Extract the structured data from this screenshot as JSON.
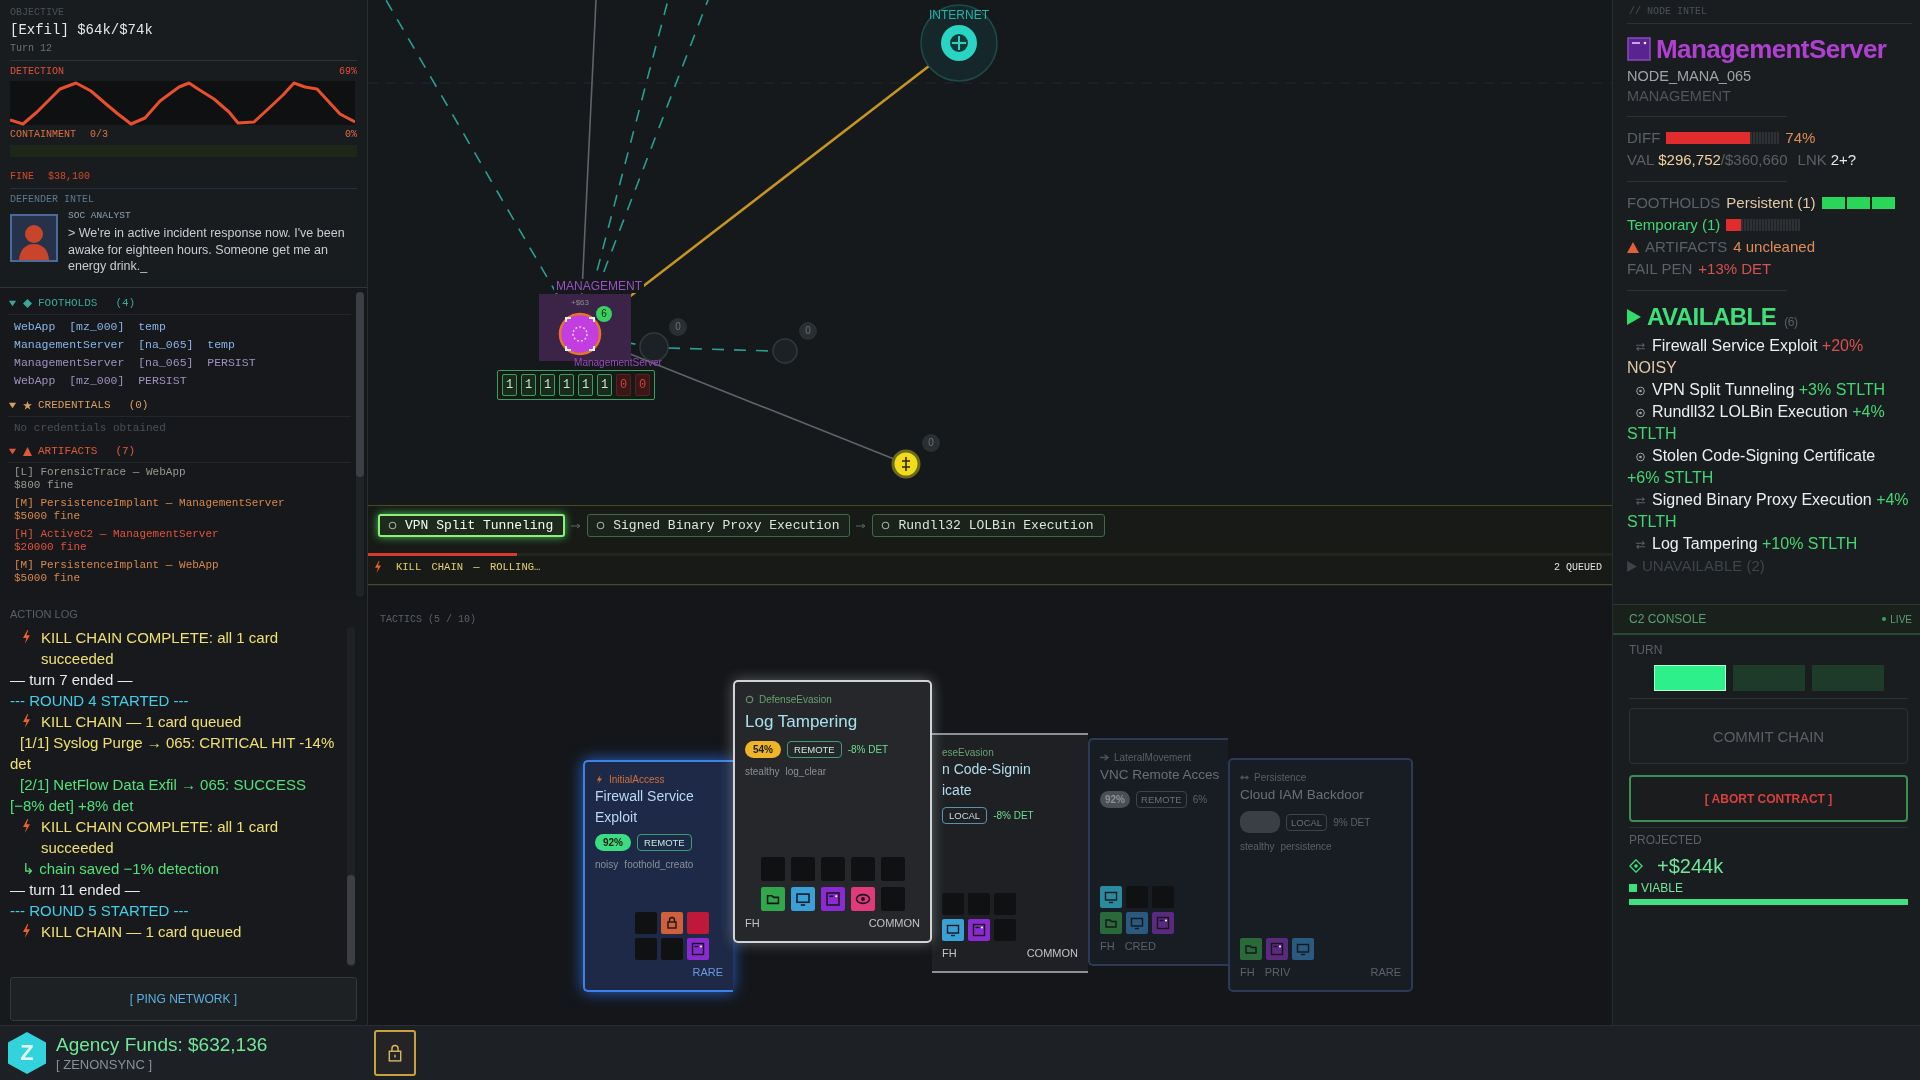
{
  "objective": {
    "label": "OBJECTIVE",
    "goal": "[Exfil] $64k/$74k",
    "turn": "Turn 12"
  },
  "detection": {
    "label": "DETECTION",
    "value": "69%"
  },
  "containment": {
    "label": "CONTAINMENT",
    "count": "0/3",
    "value": "0%"
  },
  "fine": {
    "label": "FINE",
    "value": "$38,100"
  },
  "defender": {
    "label": "DEFENDER INTEL",
    "role": "SOC ANALYST",
    "message": "> We're in active incident response now. I've been awake for eighteen hours. Someone get me an energy drink._"
  },
  "footholds": {
    "title": "FOOTHOLDS",
    "count": "(4)",
    "expanded": true,
    "items": [
      {
        "kind": "temp",
        "node": "WebApp",
        "id": "[mz_000]",
        "mode": "temp"
      },
      {
        "kind": "temp",
        "node": "ManagementServer",
        "id": "[na_065]",
        "mode": "temp"
      },
      {
        "kind": "persist",
        "node": "ManagementServer",
        "id": "[na_065]",
        "mode": "PERSIST"
      },
      {
        "kind": "persist",
        "node": "WebApp",
        "id": "[mz_000]",
        "mode": "PERSIST"
      }
    ]
  },
  "credentials": {
    "title": "CREDENTIALS",
    "count": "(0)",
    "expanded": true,
    "empty": "No credentials obtained"
  },
  "artifacts": {
    "title": "ARTIFACTS",
    "count": "(7)",
    "expanded": true,
    "items": [
      {
        "kind": "low",
        "name": "[L] ForensicTrace — WebApp",
        "fine": "$800 fine"
      },
      {
        "kind": "medium",
        "name": "[M] PersistenceImplant — ManagementServer",
        "fine": "$5000 fine"
      },
      {
        "kind": "high",
        "name": "[H] ActiveC2 — ManagementServer",
        "fine": "$20000 fine"
      },
      {
        "kind": "medium",
        "name": "[M] PersistenceImplant — WebApp",
        "fine": "$5000 fine"
      }
    ]
  },
  "action_log": {
    "title": "ACTION LOG",
    "entries": [
      {
        "kind": "chain",
        "text": "KILL CHAIN COMPLETE: all 1 card succeeded"
      },
      {
        "kind": "turn",
        "text": "— turn 7 ended —"
      },
      {
        "kind": "round",
        "text": "--- ROUND 4 STARTED ---"
      },
      {
        "kind": "chain",
        "text": "KILL CHAIN — 1 card queued"
      },
      {
        "kind": "hit",
        "text": "[1/1] Syslog Purge → 065: CRITICAL HIT -14% det"
      },
      {
        "kind": "success",
        "text": "[2/1] NetFlow Data Exfil → 065: SUCCESS [−8% det] +8% det"
      },
      {
        "kind": "chain",
        "text": "KILL CHAIN COMPLETE: all 1 card succeeded"
      },
      {
        "kind": "saved",
        "text": "↳ chain saved −1% detection"
      },
      {
        "kind": "turn",
        "text": "— turn 11 ended —"
      },
      {
        "kind": "round",
        "text": "--- ROUND 5 STARTED ---"
      },
      {
        "kind": "chain",
        "text": "KILL CHAIN — 1 card queued"
      }
    ]
  },
  "ping_button": "[ PING NETWORK ]",
  "funds": {
    "logo": "Z",
    "amount": "Agency Funds: $632,136",
    "agency": "[ ZENONSYNC ]"
  },
  "map": {
    "internet": {
      "label": "INTERNET"
    },
    "server": {
      "label": "MANAGEMENT",
      "value": "+$63",
      "name": "ManagementServer",
      "badge": "6"
    },
    "spots": [
      {
        "kind": "ghost",
        "badge": "0"
      },
      {
        "kind": "ghost",
        "badge": "0"
      },
      {
        "kind": "target",
        "badge": "0"
      }
    ],
    "foothold_cells": [
      {
        "value": "1",
        "on": true
      },
      {
        "value": "1",
        "on": true
      },
      {
        "value": "1",
        "on": true
      },
      {
        "value": "1",
        "on": true
      },
      {
        "value": "1",
        "on": true
      },
      {
        "value": "1",
        "on": true
      },
      {
        "value": "0",
        "on": false
      },
      {
        "value": "0",
        "on": false
      }
    ]
  },
  "kill_chain": {
    "items": [
      {
        "label": "VPN Split Tunneling",
        "selected": true
      },
      {
        "label": "Signed Binary Proxy Execution",
        "selected": false
      },
      {
        "label": "Rundll32 LOLBin Execution",
        "selected": false
      }
    ],
    "level": 0.12,
    "status": "KILL CHAIN — ROLLING…",
    "queued": "2 QUEUED"
  },
  "tactics": {
    "title": "TACTICS (5 / 10)",
    "cards": [
      {
        "kind": "highlighted",
        "category": "InitialAccess",
        "title_lines": [
          "Firewall Service",
          "Exploit"
        ],
        "chance": {
          "text": "92%",
          "color": "#3ddc84"
        },
        "range": "REMOTE",
        "tags": [
          "noisy",
          "foothold_creato"
        ],
        "slots": [
          {
            "kind": "empty"
          },
          {
            "kind": "lock",
            "color": "#d0603a"
          },
          {
            "kind": "block",
            "color": "#c01838"
          },
          {
            "kind": "empty"
          },
          {
            "kind": "empty"
          },
          {
            "kind": "server",
            "color": "#8a2ad0"
          }
        ],
        "rarity": "RARE"
      },
      {
        "kind": "front",
        "category": "DefenseEvasion",
        "title_lines": [
          "Log Tampering"
        ],
        "chance": {
          "text": "54%",
          "color": "#f0b429"
        },
        "range": "REMOTE",
        "effect": "-8% DET",
        "tags": [
          "stealthy",
          "log_clear"
        ],
        "slots": [
          {
            "kind": "empty"
          },
          {
            "kind": "empty"
          },
          {
            "kind": "empty"
          },
          {
            "kind": "empty"
          },
          {
            "kind": "empty"
          },
          {
            "kind": "folder",
            "color": "#2ea84a"
          },
          {
            "kind": "screen",
            "color": "#3aa0d8"
          },
          {
            "kind": "server",
            "color": "#8a2ad0"
          },
          {
            "kind": "eye",
            "color": "#e03a7a"
          },
          {
            "kind": "empty"
          }
        ],
        "labels": [
          "FH"
        ],
        "rarity": "COMMON"
      },
      {
        "kind": "covered",
        "category": "eseEvasion",
        "title_lines": [
          "n Code-Signin",
          "icate"
        ],
        "range": "LOCAL",
        "effect": "-8% DET",
        "slots": [
          {
            "kind": "empty"
          },
          {
            "kind": "empty"
          },
          {
            "kind": "empty"
          },
          {
            "kind": "screen",
            "color": "#3aa0d8"
          },
          {
            "kind": "server",
            "color": "#8a2ad0"
          },
          {
            "kind": "empty"
          }
        ],
        "labels": [
          "FH"
        ],
        "rarity": "COMMON"
      },
      {
        "kind": "faded",
        "category": "LateralMovement",
        "title_lines": [
          "VNC Remote Acces"
        ],
        "chance": {
          "text": "92%",
          "color": "#4a4f55"
        },
        "range": "REMOTE",
        "effect": "6%",
        "slots": [
          {
            "kind": "screen",
            "color": "#2a8aa0"
          },
          {
            "kind": "empty"
          },
          {
            "kind": "empty"
          },
          {
            "kind": "folder",
            "color": "#2a6a3a"
          },
          {
            "kind": "screen",
            "color": "#2a5a80"
          },
          {
            "kind": "server",
            "color": "#5a2a80"
          }
        ],
        "labels": [
          "FH",
          "CRED"
        ]
      },
      {
        "kind": "faded",
        "category": "Persistence",
        "title_lines": [
          "Cloud IAM Backdoor"
        ],
        "chance": {
          "color": "#3a3f45"
        },
        "range": "LOCAL",
        "effect": "9% DET",
        "tags": [
          "stealthy",
          "persistence"
        ],
        "slots": [
          {
            "kind": "folder",
            "color": "#2a6a3a"
          },
          {
            "kind": "server",
            "color": "#5a2a80"
          },
          {
            "kind": "screen",
            "color": "#2a5a80"
          }
        ],
        "labels": [
          "FH",
          "PRIV"
        ],
        "rarity": "RARE"
      }
    ]
  },
  "node_intel": {
    "header": "// NODE INTEL",
    "name": "ManagementServer",
    "node_id": "NODE_MANA_065",
    "node_type": "MANAGEMENT",
    "diff": {
      "label": "DIFF",
      "level": 0.74,
      "value": "74%"
    },
    "value": {
      "label": "VAL",
      "current": "$296,752",
      "max": "/$360,660",
      "link_label": "LNK",
      "links": "2+?"
    },
    "footholds": {
      "label": "FOOTHOLDS",
      "persistent": {
        "text": "Persistent (1)",
        "level": 1
      },
      "temporary": {
        "text": "Temporary (1)",
        "level": 0.2
      }
    },
    "artifacts": {
      "label": "ARTIFACTS",
      "value": "4 uncleaned"
    },
    "fail_pen": {
      "label": "FAIL PEN",
      "value": "+13% DET"
    },
    "available": {
      "title": "AVAILABLE",
      "count": "(6)",
      "items": [
        {
          "kind": "remote",
          "name": "Firewall Service Exploit",
          "amount": "+20%",
          "tag": "NOISY",
          "noisy": true
        },
        {
          "kind": "local",
          "name": "VPN Split Tunneling",
          "amount": "+3%",
          "tag": "STLTH",
          "noisy": false
        },
        {
          "kind": "local",
          "name": "Rundll32 LOLBin Execution",
          "amount": "+4%",
          "tag": "STLTH",
          "noisy": false
        },
        {
          "kind": "local",
          "name": "Stolen Code-Signing Certificate",
          "amount": "+6%",
          "tag": "STLTH",
          "noisy": false
        },
        {
          "kind": "remote",
          "name": "Signed Binary Proxy Execution",
          "amount": "+4%",
          "tag": "STLTH",
          "noisy": false
        },
        {
          "kind": "remote",
          "name": "Log Tampering",
          "amount": "+10%",
          "tag": "STLTH",
          "noisy": false
        }
      ]
    },
    "unavailable": {
      "title": "UNAVAILABLE",
      "count": "(2)",
      "expanded": false
    }
  },
  "c2_console": {
    "title": "C2 CONSOLE",
    "status": "LIVE",
    "turn_label": "TURN",
    "turn_segments": [
      {
        "on": true
      },
      {
        "on": false
      },
      {
        "on": false
      }
    ],
    "commit": {
      "label": "COMMIT CHAIN",
      "disabled": true
    },
    "abort": "[ ABORT CONTRACT ]",
    "projected": {
      "label": "PROJECTED",
      "value": "+$244k",
      "status": "VIABLE",
      "level": 1
    }
  }
}
